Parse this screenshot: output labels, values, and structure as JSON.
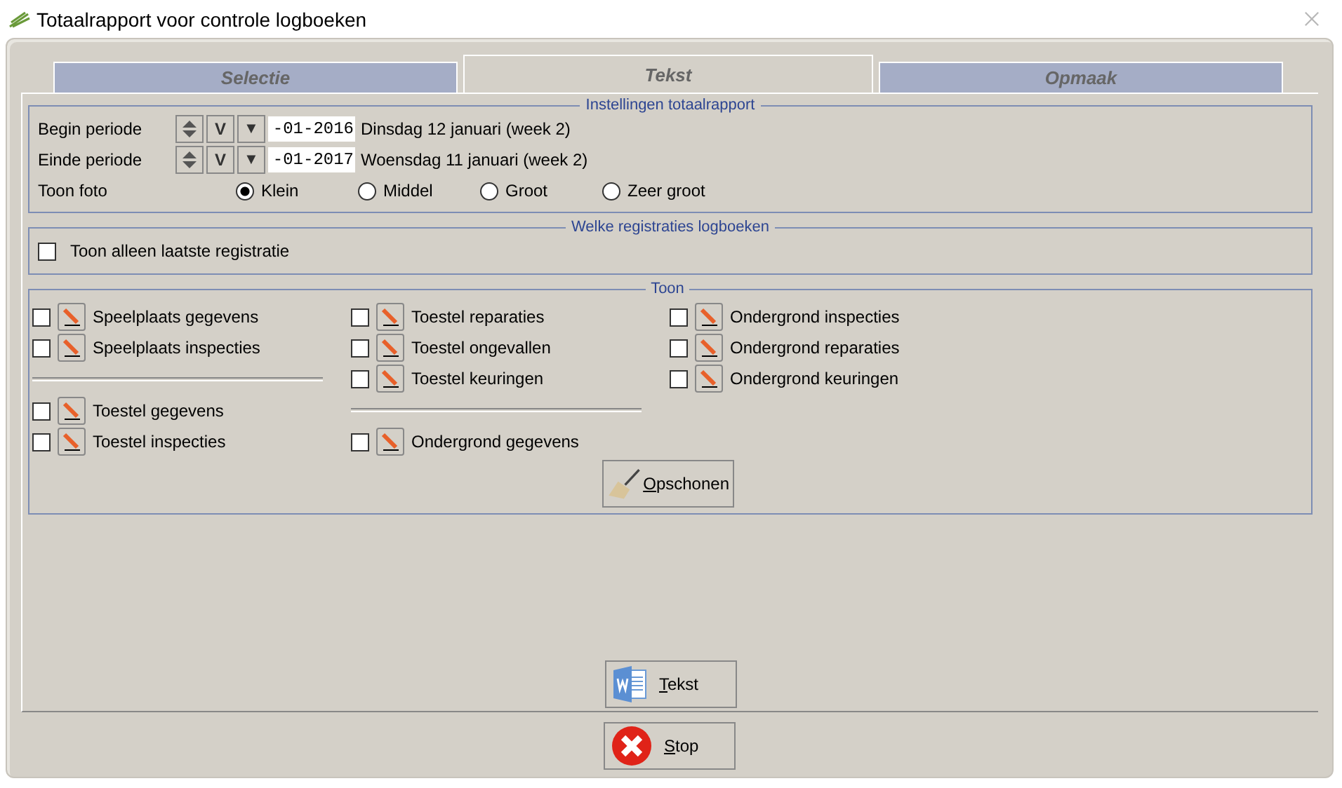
{
  "window": {
    "title": "Totaalrapport voor controle logboeken"
  },
  "tabs": [
    {
      "label": "Selectie",
      "selected": false
    },
    {
      "label": "Tekst",
      "selected": true
    },
    {
      "label": "Opmaak",
      "selected": false
    }
  ],
  "settings": {
    "legend": "Instellingen totaalrapport",
    "periods": [
      {
        "label": "Begin periode",
        "button_v": "V",
        "button_down": "▼",
        "value": "-01-2016",
        "description": "Dinsdag 12 januari (week 2)"
      },
      {
        "label": "Einde periode",
        "button_v": "V",
        "button_down": "▼",
        "value": "-01-2017",
        "description": "Woensdag 11 januari (week 2)"
      }
    ],
    "photo": {
      "label": "Toon foto",
      "options": [
        {
          "label": "Klein",
          "selected": true
        },
        {
          "label": "Middel",
          "selected": false
        },
        {
          "label": "Groot",
          "selected": false
        },
        {
          "label": "Zeer groot",
          "selected": false
        }
      ]
    }
  },
  "registrations": {
    "legend": "Welke registraties logboeken",
    "option": {
      "label": "Toon alleen laatste registratie",
      "checked": false
    }
  },
  "show": {
    "legend": "Toon",
    "columns": [
      [
        [
          {
            "label": "Speelplaats gegevens",
            "checked": false
          },
          {
            "label": "Speelplaats inspecties",
            "checked": false
          }
        ],
        [
          {
            "label": "Toestel gegevens",
            "checked": false
          },
          {
            "label": "Toestel inspecties",
            "checked": false
          }
        ]
      ],
      [
        [
          {
            "label": "Toestel reparaties",
            "checked": false
          },
          {
            "label": "Toestel ongevallen",
            "checked": false
          },
          {
            "label": "Toestel keuringen",
            "checked": false
          }
        ],
        [
          {
            "label": "Ondergrond gegevens",
            "checked": false
          }
        ]
      ],
      [
        [
          {
            "label": "Ondergrond inspecties",
            "checked": false
          },
          {
            "label": "Ondergrond reparaties",
            "checked": false
          },
          {
            "label": "Ondergrond keuringen",
            "checked": false
          }
        ]
      ]
    ],
    "clean_button": "Opschonen"
  },
  "text_button": "Tekst",
  "stop_button": "Stop"
}
